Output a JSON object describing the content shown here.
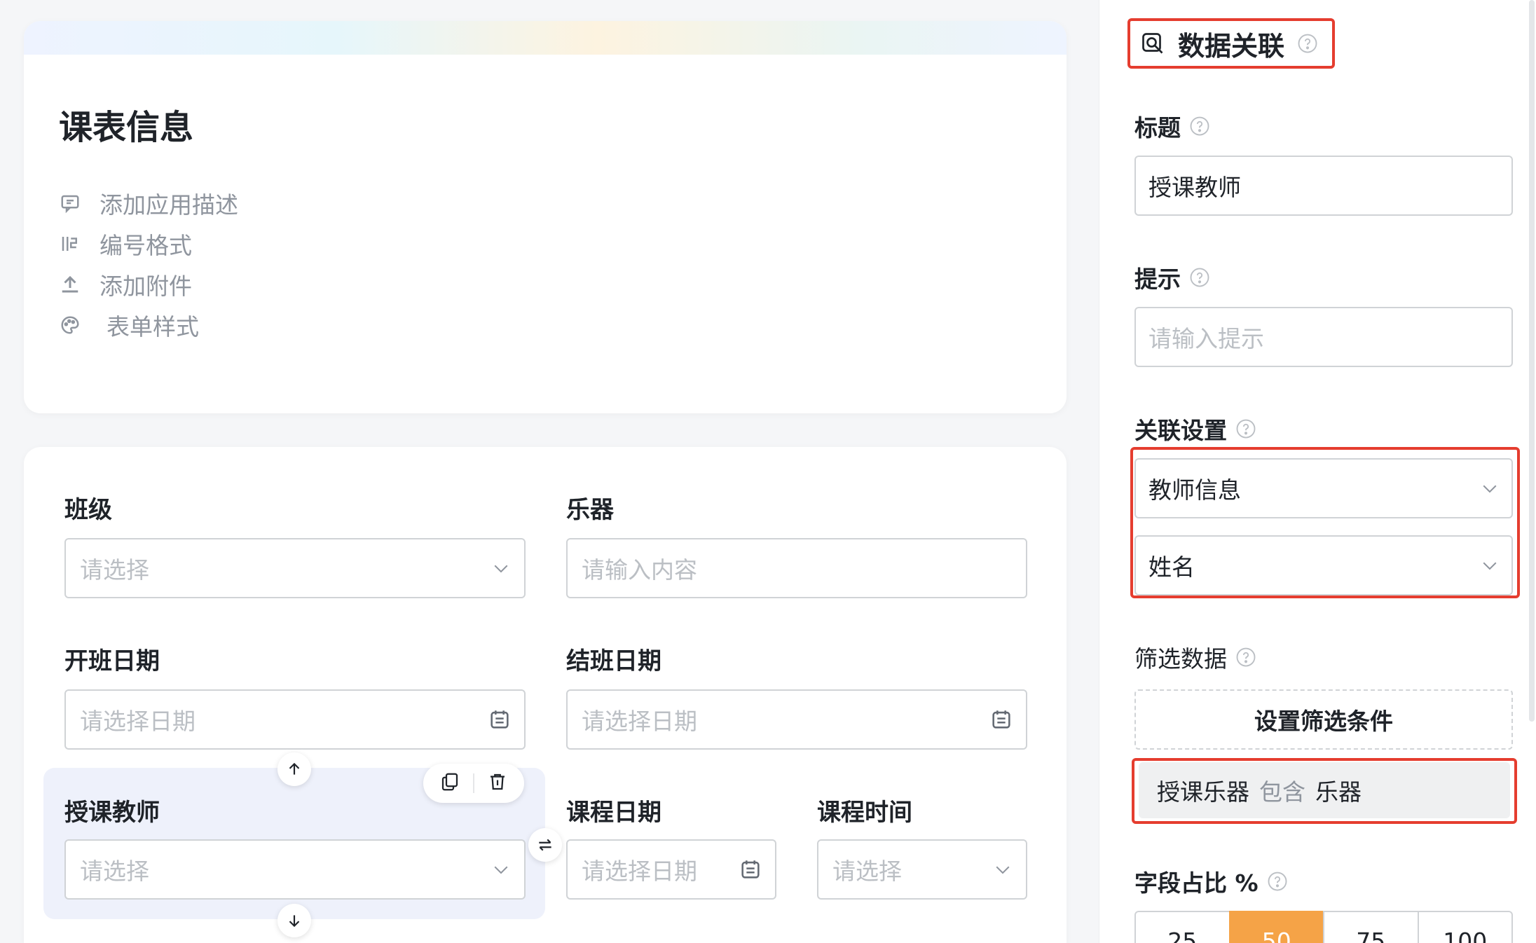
{
  "form": {
    "title": "课表信息",
    "menu": [
      {
        "label": "添加应用描述",
        "icon": "comment-icon"
      },
      {
        "label": "编号格式",
        "icon": "numbering-icon"
      },
      {
        "label": "添加附件",
        "icon": "upload-icon"
      },
      {
        "label": "表单样式",
        "icon": "palette-icon"
      }
    ],
    "fields": {
      "class": {
        "label": "班级",
        "placeholder": "请选择"
      },
      "instrument": {
        "label": "乐器",
        "placeholder": "请输入内容"
      },
      "start_date": {
        "label": "开班日期",
        "placeholder": "请选择日期"
      },
      "end_date": {
        "label": "结班日期",
        "placeholder": "请选择日期"
      },
      "teacher": {
        "label": "授课教师",
        "placeholder": "请选择"
      },
      "course_date": {
        "label": "课程日期",
        "placeholder": "请选择日期"
      },
      "course_time": {
        "label": "课程时间",
        "placeholder": "请选择"
      }
    }
  },
  "panel": {
    "title": "数据关联",
    "title_label": "标题",
    "title_value": "授课教师",
    "hint_label": "提示",
    "hint_placeholder": "请输入提示",
    "relation_label": "关联设置",
    "relation_table": "教师信息",
    "relation_field": "姓名",
    "filter_label": "筛选数据",
    "filter_button": "设置筛选条件",
    "condition": {
      "field": "授课乐器",
      "operator": "包含",
      "value": "乐器"
    },
    "ratio_label": "字段占比 %",
    "ratio_options": [
      "25",
      "50",
      "75",
      "100"
    ],
    "ratio_selected": "50"
  },
  "colors": {
    "highlight": "#e53d2f",
    "accent": "#f5a347",
    "selected_bg": "#eef1fb"
  }
}
